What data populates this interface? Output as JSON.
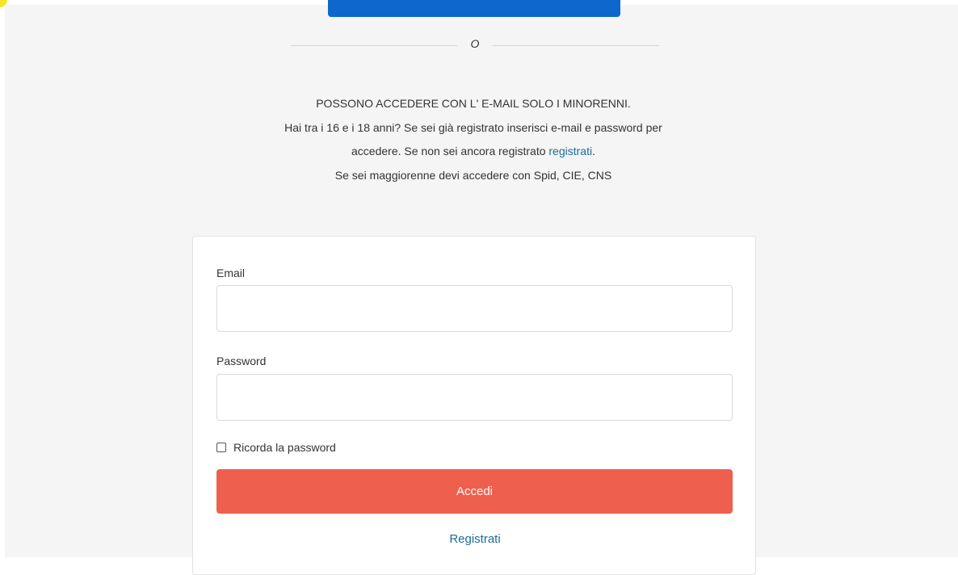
{
  "colors": {
    "primary_blue": "#0d67cc",
    "accent_red": "#ef5f4d",
    "link": "#1c6a9a",
    "page_background": "#f5f5f5"
  },
  "separator": {
    "label": "O"
  },
  "notice": {
    "line1": "POSSONO ACCEDERE CON L' E-MAIL SOLO I MINORENNI.",
    "line2": "Hai tra i 16 e i 18 anni? Se sei già registrato inserisci e-mail e password per",
    "line3_before": "accedere. Se non sei ancora registrato ",
    "line3_link": "registrati",
    "line3_after": ".",
    "line4": "Se sei maggiorenne devi accedere con Spid, CIE, CNS"
  },
  "form": {
    "email_label": "Email",
    "email_value": "",
    "password_label": "Password",
    "password_value": "",
    "remember_label": "Ricorda la password",
    "remember_checked": false,
    "submit_label": "Accedi",
    "register_label": "Registrati"
  }
}
